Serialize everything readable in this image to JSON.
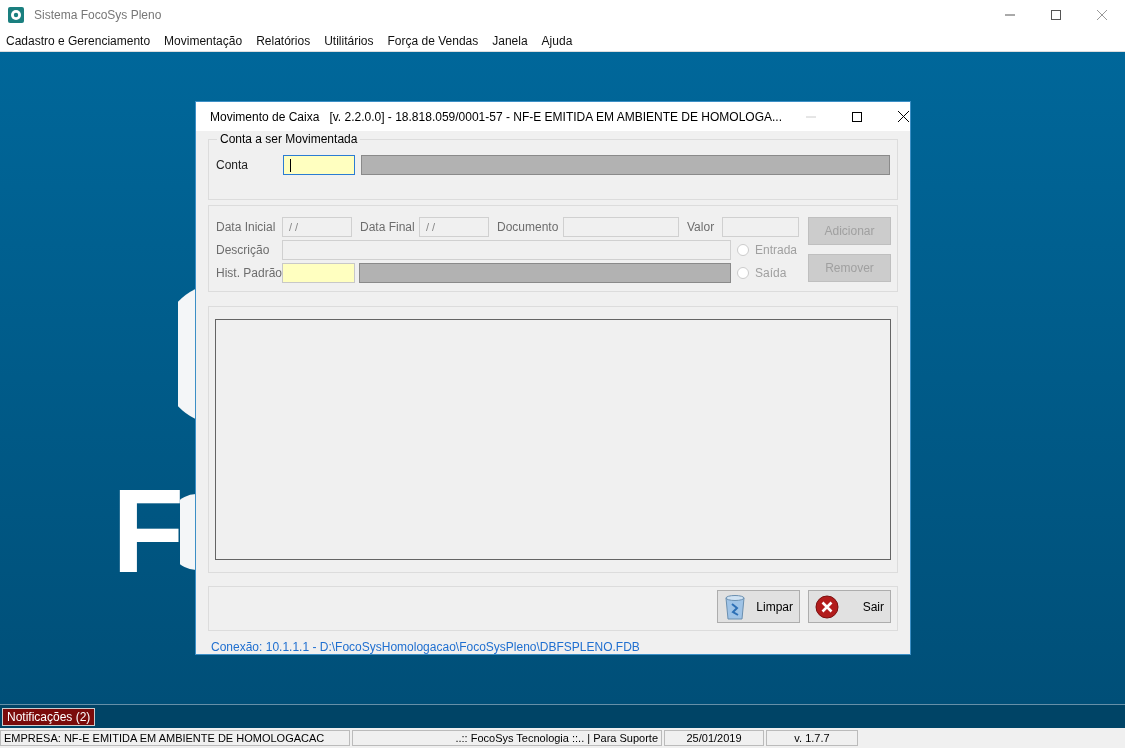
{
  "window": {
    "title": "Sistema FocoSys Pleno"
  },
  "menu": [
    "Cadastro e Gerenciamento",
    "Movimentação",
    "Relatórios",
    "Utilitários",
    "Força de Vendas",
    "Janela",
    "Ajuda"
  ],
  "background_logo": "F",
  "dialog": {
    "title": "Movimento de Caixa   [v. 2.2.0.0] - 18.818.059/0001-57 - NF-E EMITIDA EM AMBIENTE DE HOMOLOGA...",
    "account_group": {
      "legend": "Conta a ser Movimentada",
      "label": "Conta"
    },
    "entry_group": {
      "data_inicial": {
        "label": "Data Inicial",
        "value": "/ /"
      },
      "data_final": {
        "label": "Data Final",
        "value": "/ /"
      },
      "documento": {
        "label": "Documento"
      },
      "valor": {
        "label": "Valor"
      },
      "descricao": {
        "label": "Descrição"
      },
      "hist_padrao": {
        "label": "Hist. Padrão"
      },
      "radios": [
        {
          "label": "Entrada",
          "selected": false,
          "disabled": true
        },
        {
          "label": "Saída",
          "selected": false,
          "disabled": true
        }
      ],
      "buttons": [
        {
          "label": "Adicionar",
          "disabled": true
        },
        {
          "label": "Remover",
          "disabled": true
        }
      ]
    },
    "footer_buttons": [
      {
        "kind": "clear",
        "label": "Limpar"
      },
      {
        "kind": "exit",
        "label": "Sair"
      }
    ],
    "connection": "Conexão: 10.1.1.1 - D:\\FocoSysHomologacao\\FocoSysPleno\\DBFSPLENO.FDB"
  },
  "notifications": "Notificações (2)",
  "status_bar": [
    "EMPRESA: NF-E EMITIDA EM AMBIENTE DE HOMOLOGACAC",
    "..:: FocoSys Tecnologia ::.. | Para Suporte",
    "25/01/2019",
    "v. 1.7.7"
  ]
}
